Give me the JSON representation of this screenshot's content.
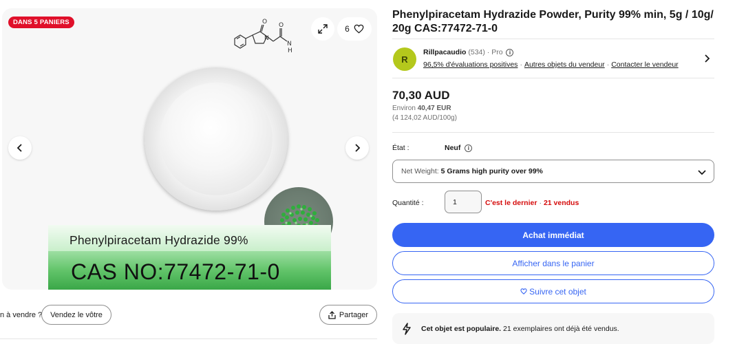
{
  "gallery": {
    "badge": "DANS 5 PANIERS",
    "watch_count": "6",
    "image_label_name": "Phenylpiracetam Hydrazide  99%",
    "image_label_cas": "CAS NO:77472-71-0",
    "molecule_labels": {
      "o": "O",
      "n": "N",
      "nh": "N",
      "h": "H"
    },
    "icons": {
      "expand": "expand-icon",
      "heart": "heart-icon",
      "prev": "chevron-left-icon",
      "next": "chevron-right-icon",
      "share": "share-icon"
    }
  },
  "sell": {
    "prompt": "n à vendre ?",
    "button": "Vendez le vôtre"
  },
  "share": {
    "label": "Partager"
  },
  "item": {
    "title": "Phenylpiracetam Hydrazide Powder, Purity 99% min, 5g / 10g/ 20g CAS:77472-71-0"
  },
  "seller": {
    "initial": "R",
    "avatar_color": "#b4c81c",
    "name": "Rillpacaudio",
    "count": "(534)",
    "separator": "·",
    "pro": "Pro",
    "feedback": "96,5% d'évaluations positives",
    "other_items": "Autres objets du vendeur",
    "contact": "Contacter le vendeur"
  },
  "price": {
    "amount": "70,30 AUD",
    "approx_prefix": "Environ",
    "approx_value": "40,47 EUR",
    "unit_price": "(4 124,02 AUD/100g)"
  },
  "condition": {
    "label": "État :",
    "value": "Neuf"
  },
  "variation": {
    "label": "Net Weight:",
    "selected": "5 Grams high purity over 99%"
  },
  "quantity": {
    "label": "Quantité :",
    "value": "1",
    "last_item": "C'est le dernier",
    "sold": "21 vendus"
  },
  "actions": {
    "buy_now": "Achat immédiat",
    "view_cart": "Afficher dans le panier",
    "watch": "Suivre cet objet"
  },
  "popular": {
    "bold": "Cet objet est populaire.",
    "text": " 21 exemplaires ont déjà été vendus."
  },
  "colors": {
    "accent": "#3665f3",
    "badge": "#e0102a",
    "warning": "#d50b0b"
  }
}
